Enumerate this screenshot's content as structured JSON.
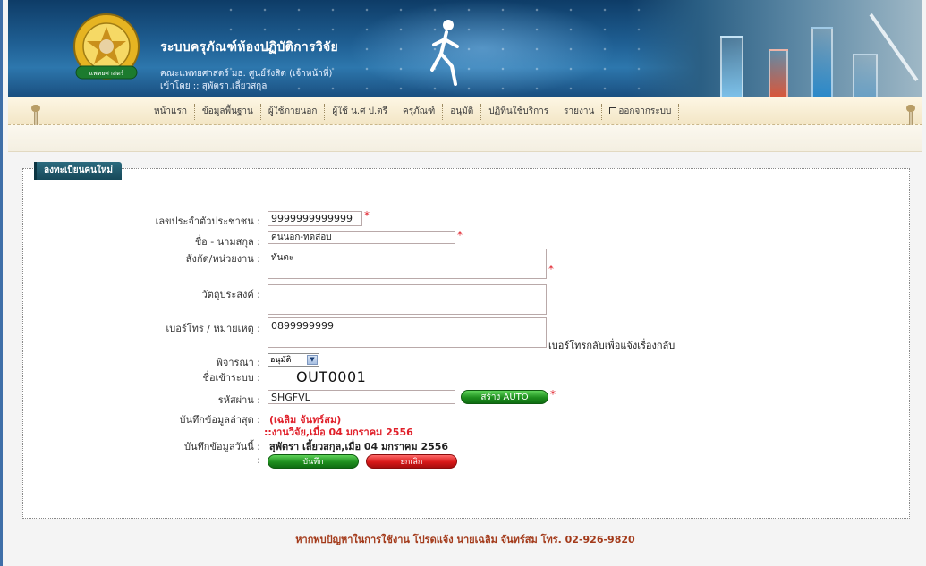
{
  "header": {
    "title": "ระบบครุภัณฑ์ห้องปฏิบัติการวิจัย",
    "subtitle": "คณะแพทยศาสตร์ มธ. ศูนย์รังสิต (เจ้าหน้าที่)",
    "logged_in": "เข้าโดย :: สุพัตรา เลี้ยวสกุล",
    "logo_text": "แพทยศาสตร์"
  },
  "nav": {
    "items": [
      {
        "label": "หน้าแรก"
      },
      {
        "label": "ข้อมูลพื้นฐาน"
      },
      {
        "label": "ผู้ใช้ภายนอก"
      },
      {
        "label": "ผู้ใช้ น.ศ ป.ตรี"
      },
      {
        "label": "ครุภัณฑ์"
      },
      {
        "label": "อนุมัติ"
      },
      {
        "label": "ปฏิทินใช้บริการ"
      },
      {
        "label": "รายงาน"
      },
      {
        "label": "ออกจากระบบ"
      }
    ]
  },
  "form": {
    "section_title": "ลงทะเบียนคนใหม่",
    "id_card_label": "เลขประจำตัวประชาชน :",
    "id_card_value": "9999999999999",
    "name_label": "ชื่อ - นามสกุล :",
    "name_value": "คนนอก-ทดสอบ",
    "affiliation_label": "สังกัด/หน่วยงาน :",
    "affiliation_value": "ทันตะ",
    "purpose_label": "วัตถุประสงค์ :",
    "purpose_value": "",
    "phone_label": "เบอร์โทร / หมายเหตุ :",
    "phone_value": "0899999999",
    "phone_hint": "เบอร์โทรกลับเพื่อแจ้งเรื่องกลับ",
    "consider_label": "พิจารณา :",
    "consider_value": "อนุมัติ",
    "username_label": "ชื่อเข้าระบบ :",
    "username_value": "OUT0001",
    "password_label": "รหัสผ่าน :",
    "password_value": "SHGFVL",
    "auto_button": "สร้าง AUTO",
    "last_saved_label": "บันทึกข้อมูลล่าสุด :",
    "last_saved_name": "(เฉลิม จันทร์สม)",
    "last_saved_detail": "::งานวิจัย,เมื่อ 04 มกราคม 2556",
    "today_label": "บันทึกข้อมูลวันนี้ :",
    "today_value": "สุพัตรา เลี้ยวสกุล,เมื่อ 04 มกราคม 2556",
    "colon": ":",
    "save_button": "บันทึก",
    "cancel_button": "ยกเลิก",
    "required_mark": "*"
  },
  "footer": {
    "text": "หากพบปัญหาในการใช้งาน โปรดแจ้ง นายเฉลิม จันทร์สม โทร. 02-926-9820"
  },
  "colors": {
    "banner": "#1f5f93",
    "tab": "#17495a",
    "required": "#e0202a",
    "footer_text": "#a33a1a",
    "save": "#1e8f1e",
    "cancel": "#d81818"
  }
}
